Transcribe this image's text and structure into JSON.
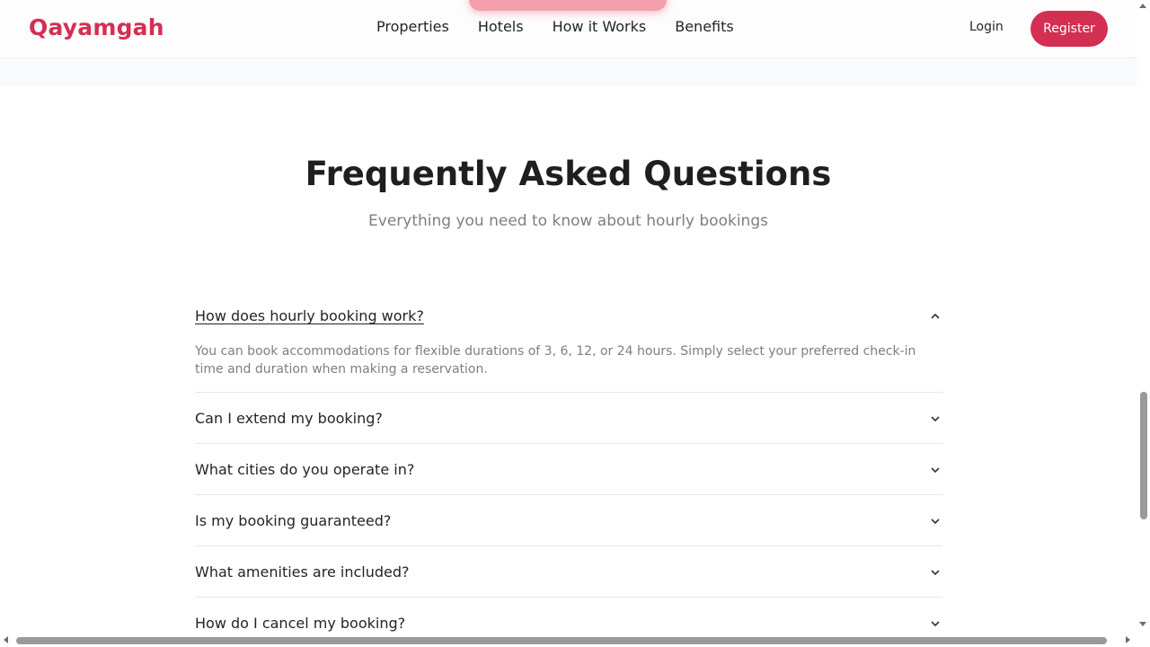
{
  "header": {
    "logo": "Qayamgah",
    "nav": [
      "Properties",
      "Hotels",
      "How it Works",
      "Benefits"
    ],
    "login_label": "Login",
    "register_label": "Register"
  },
  "colors": {
    "brand": "#d32f52",
    "muted_text": "#7b7f86"
  },
  "faq": {
    "title": "Frequently Asked Questions",
    "subtitle": "Everything you need to know about hourly bookings",
    "items": [
      {
        "question": "How does hourly booking work?",
        "answer": "You can book accommodations for flexible durations of 3, 6, 12, or 24 hours. Simply select your preferred check-in time and duration when making a reservation.",
        "expanded": true,
        "icon": "chevron-up-icon"
      },
      {
        "question": "Can I extend my booking?",
        "expanded": false,
        "icon": "chevron-down-icon"
      },
      {
        "question": "What cities do you operate in?",
        "expanded": false,
        "icon": "chevron-down-icon"
      },
      {
        "question": "Is my booking guaranteed?",
        "expanded": false,
        "icon": "chevron-down-icon"
      },
      {
        "question": "What amenities are included?",
        "expanded": false,
        "icon": "chevron-down-icon"
      },
      {
        "question": "How do I cancel my booking?",
        "expanded": false,
        "icon": "chevron-down-icon"
      }
    ]
  }
}
